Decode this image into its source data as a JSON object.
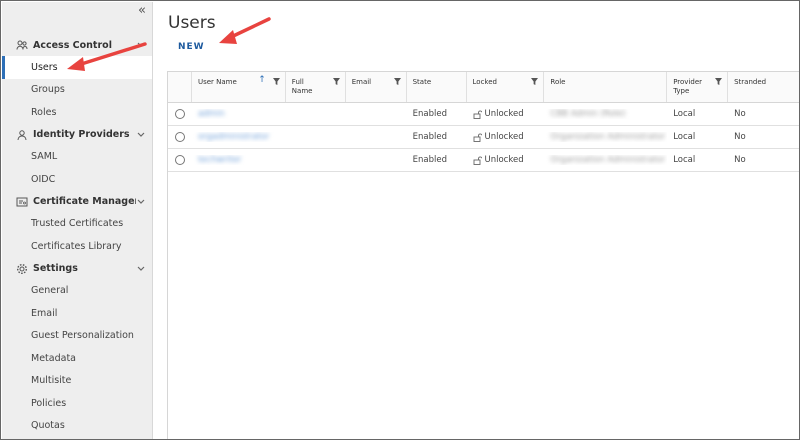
{
  "sidebar": {
    "collapse_glyph": "«",
    "groups": [
      {
        "label": "Access Control",
        "icon": "users-group-icon",
        "items": [
          "Users",
          "Groups",
          "Roles"
        ]
      },
      {
        "label": "Identity Providers",
        "icon": "id-card-icon",
        "items": [
          "SAML",
          "OIDC"
        ]
      },
      {
        "label": "Certificate Managem...",
        "icon": "certificate-icon",
        "items": [
          "Trusted Certificates",
          "Certificates Library"
        ]
      },
      {
        "label": "Settings",
        "icon": "gear-icon",
        "items": [
          "General",
          "Email",
          "Guest Personalization",
          "Metadata",
          "Multisite",
          "Policies",
          "Quotas"
        ]
      }
    ],
    "active_item": "Users"
  },
  "main": {
    "title": "Users",
    "new_button": "NEW"
  },
  "grid": {
    "columns": [
      "User Name",
      "Full Name",
      "Email",
      "State",
      "Locked",
      "Role",
      "Provider Type",
      "Stranded"
    ],
    "rows": [
      {
        "username": "admin",
        "fullname": "",
        "email": "",
        "state": "Enabled",
        "locked": "Unlocked",
        "role": "CBB Admin (Role)",
        "provider": "Local",
        "stranded": "No"
      },
      {
        "username": "orgadministrator",
        "fullname": "",
        "email": "",
        "state": "Enabled",
        "locked": "Unlocked",
        "role": "Organization Administrator",
        "provider": "Local",
        "stranded": "No"
      },
      {
        "username": "techwriter",
        "fullname": "",
        "email": "",
        "state": "Enabled",
        "locked": "Unlocked",
        "role": "Organization Administrator",
        "provider": "Local",
        "stranded": "No"
      }
    ]
  },
  "colors": {
    "accent": "#2d6fb7",
    "arrow": "#e8433f",
    "sidebar_bg": "#eeeeee"
  }
}
